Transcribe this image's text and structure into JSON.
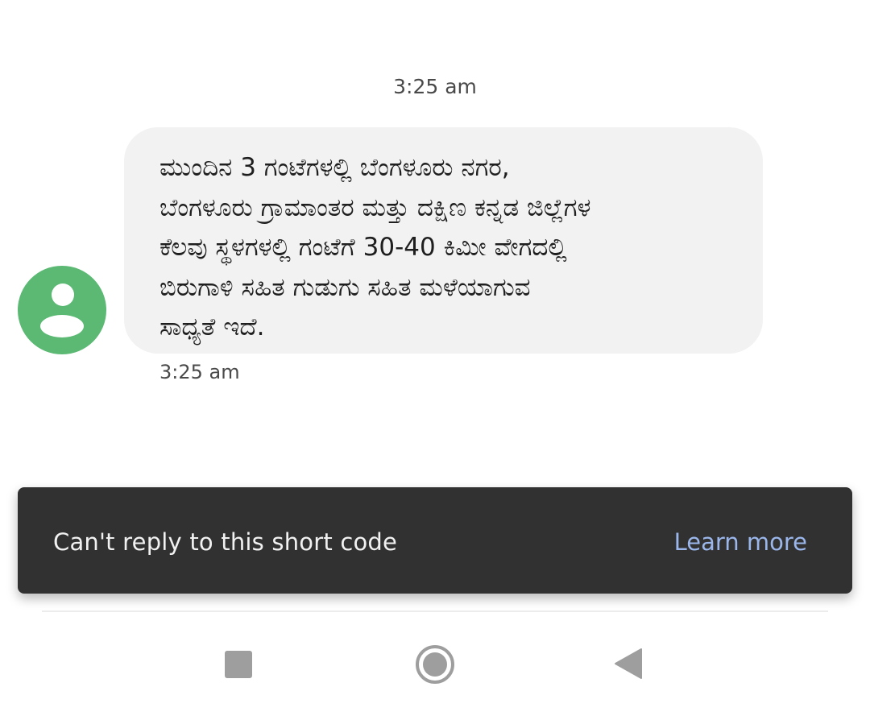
{
  "conversation": {
    "top_timestamp": "3:25 am",
    "message": {
      "text": "ಮುಂದಿನ 3 ಗಂಟೆಗಳಲ್ಲಿ ಬೆಂಗಳೂರು ನಗರ,\nಬೆಂಗಳೂರು ಗ್ರಾಮಾಂತರ ಮತ್ತು ದಕ್ಷಿಣ ಕನ್ನಡ ಜಿಲ್ಲೆಗಳ\nಕೆಲವು ಸ್ಥಳಗಳಲ್ಲಿ ಗಂಟೆಗೆ 30-40 ಕಿಮೀ ವೇಗದಲ್ಲಿ\nಬಿರುಗಾಳಿ ಸಹಿತ ಗುಡುಗು ಸಹಿತ ಮಳೆಯಾಗುವ\nಸಾಧ್ಯತೆ ಇದೆ.",
      "timestamp": "3:25 am"
    },
    "avatar": {
      "icon": "person-icon",
      "color": "#5bb974"
    }
  },
  "snackbar": {
    "message": "Can't reply to this short code",
    "action_label": "Learn more",
    "background_color": "#313131",
    "action_color": "#9ab6ea"
  },
  "nav_bar": {
    "buttons": [
      {
        "icon": "recents-square-icon"
      },
      {
        "icon": "home-circle-icon"
      },
      {
        "icon": "back-triangle-icon"
      }
    ]
  }
}
